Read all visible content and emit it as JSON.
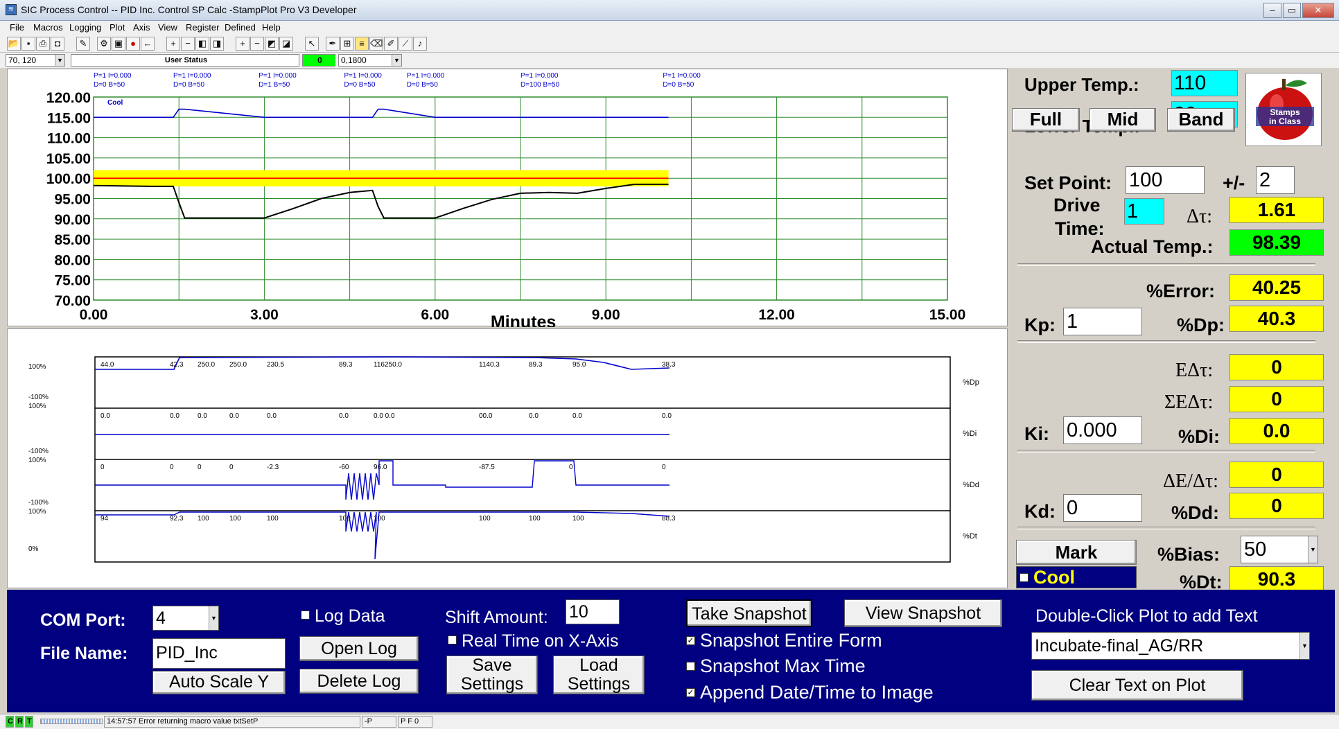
{
  "window": {
    "title": "SIC Process Control -- PID Inc. Control SP Calc -StampPlot Pro V3 Developer"
  },
  "menu": [
    "File",
    "Macros",
    "Logging",
    "Plot",
    "Axis",
    "View",
    "Register",
    "Defined",
    "Help"
  ],
  "statusrow": {
    "coords": "70, 120",
    "user_status": "User Status",
    "green_value": "0",
    "value": "0,1800"
  },
  "plot1": {
    "y_ticks": [
      "120.00",
      "115.00",
      "110.00",
      "105.00",
      "100.00",
      "95.00",
      "90.00",
      "85.00",
      "80.00",
      "75.00",
      "70.00"
    ],
    "x_ticks": [
      "0.00",
      "3.00",
      "6.00",
      "9.00",
      "12.00",
      "15.00"
    ],
    "x_label": "Minutes",
    "cool_label": "Cool",
    "annotations": [
      {
        "line1": "P=1 I=0.000",
        "line2": "D=0 B=50"
      },
      {
        "line1": "P=1 I=0.000",
        "line2": "D=0 B=50"
      },
      {
        "line1": "P=1 I=0.000",
        "line2": "D=1 B=50"
      },
      {
        "line1": "P=1 I=0.000",
        "line2": "D=0 B=50"
      },
      {
        "line1": "P=1 I=0.000",
        "line2": "D=0 B=50"
      },
      {
        "line1": "P=1 I=0.000",
        "line2": "D=100 B=50"
      },
      {
        "line1": "P=1 I=0.000",
        "line2": "D=0 B=50"
      }
    ]
  },
  "chart_data": {
    "type": "line",
    "xlabel": "Minutes",
    "ylabel": "",
    "xlim": [
      0,
      15
    ],
    "ylim": [
      70,
      120
    ],
    "x": [
      0,
      1.0,
      1.4,
      1.5,
      1.6,
      3.0,
      3.5,
      4.0,
      4.5,
      4.9,
      5.0,
      5.1,
      6.0,
      6.5,
      7.0,
      7.5,
      8.0,
      8.5,
      9.0,
      9.5,
      10.1
    ],
    "series": [
      {
        "name": "Actual Temp",
        "values": [
          98.2,
          98.0,
          98.0,
          94.0,
          90.2,
          90.2,
          92.5,
          95.0,
          96.5,
          97.0,
          93.0,
          90.2,
          90.2,
          92.6,
          94.8,
          96.3,
          96.5,
          96.3,
          97.5,
          98.5,
          98.5
        ]
      },
      {
        "name": "Set Point",
        "values": [
          100,
          100,
          100,
          100,
          100,
          100,
          100,
          100,
          100,
          100,
          100,
          100,
          100,
          100,
          100,
          100,
          100,
          100,
          100,
          100,
          100
        ]
      },
      {
        "name": "Cool",
        "values": [
          115,
          115,
          115,
          117,
          117,
          115,
          115,
          115,
          115,
          115,
          117,
          117,
          115,
          115,
          115,
          115,
          115,
          115,
          115,
          115,
          115
        ]
      }
    ],
    "band": {
      "low": 98,
      "high": 102
    }
  },
  "plot2": {
    "left_labels": [
      "100%",
      "-100%",
      "100%",
      "-100%",
      "100%",
      "-100%",
      "100%",
      "0%"
    ],
    "right_labels": [
      "%Dp",
      "%Di",
      "%Dd",
      "%Dt"
    ],
    "dp_values": [
      "44.0",
      "42.3",
      "250.0",
      "250.0",
      "230.5",
      "89.3",
      "116250.0",
      "1140.3",
      "89.3",
      "95.0",
      "38.3"
    ],
    "di_values": [
      "0.0",
      "0.0",
      "0.0",
      "0.0",
      "0.0",
      "0.0",
      "0.0 0.0",
      "00.0",
      "0.0",
      "0.0",
      "0.0"
    ],
    "dd_values": [
      "0",
      "0",
      "0",
      "0",
      "-2.3",
      "-60",
      "96.0",
      "-87.5",
      "0",
      "0"
    ],
    "dt_values": [
      "94",
      "92.3",
      "100",
      "100",
      "100",
      "100",
      "100",
      "100",
      "100",
      "100",
      "88.3"
    ]
  },
  "right": {
    "upper_temp_label": "Upper Temp.:",
    "upper_temp": "110",
    "lower_temp_label": "Lower Temp.:",
    "lower_temp": "90",
    "full": "Full",
    "mid": "Mid",
    "band": "Band",
    "set_point_label": "Set Point:",
    "set_point": "100",
    "plusminus_label": "+/-",
    "plusminus": "2",
    "drive_label": "Drive",
    "time_label": "Time:",
    "drive_time": "1",
    "dt_label": "Δτ:",
    "dt_value": "1.61",
    "actual_label": "Actual Temp.:",
    "actual_value": "98.39",
    "error_label": "%Error:",
    "error_value": "40.25",
    "kp_label": "Kp:",
    "kp": "1",
    "dp_label": "%Dp:",
    "dp_value": "40.3",
    "e_dt_label": "EΔτ:",
    "e_dt_value": "0",
    "sum_label": "ΣEΔτ:",
    "sum_value": "0",
    "ki_label": "Ki:",
    "ki": "0.000",
    "di_label": "%Di:",
    "di_value": "0.0",
    "de_label": "ΔE/Δτ:",
    "de_value": "0",
    "kd_label": "Kd:",
    "kd": "0",
    "dd_label": "%Dd:",
    "dd_value": "0",
    "mark": "Mark",
    "bias_label": "%Bias:",
    "bias": "50",
    "cool": "Cool",
    "dtpct_label": "%Dt:",
    "dtpct_value": "90.3"
  },
  "bottom": {
    "com_label": "COM Port:",
    "com_value": "4",
    "file_label": "File Name:",
    "file_value": "PID_Inc",
    "autoscale": "Auto Scale Y",
    "log_data": "Log Data",
    "open_log": "Open Log",
    "delete_log": "Delete Log",
    "shift_label": "Shift Amount:",
    "shift_value": "10",
    "realtime": "Real Time on X-Axis",
    "save1": "Save",
    "save2": "Settings",
    "load1": "Load",
    "load2": "Settings",
    "take_snapshot": "Take Snapshot",
    "view_snapshot": "View Snapshot",
    "snap_entire": "Snapshot Entire Form",
    "snap_max": "Snapshot Max Time",
    "append_date": "Append Date/Time to Image",
    "dblclick": "Double-Click Plot to add Text",
    "combo_value": "Incubate-final_AG/RR",
    "clear_text": "Clear Text on Plot"
  },
  "statusbar": {
    "c": "C",
    "r": "R",
    "t": "T",
    "message": "14:57:57 Error returning macro value txtSetP",
    "p": "-P",
    "pf": "P F 0"
  }
}
